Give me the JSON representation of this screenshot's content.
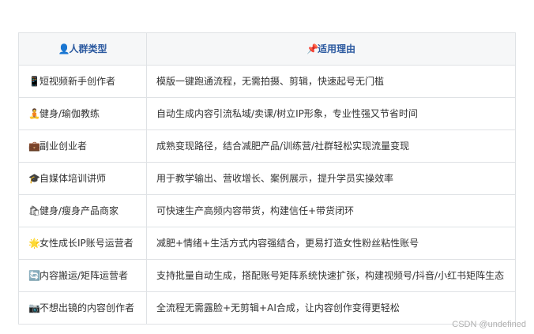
{
  "table": {
    "headers": [
      {
        "icon": "👤",
        "icon_name": "person-icon",
        "label": "人群类型"
      },
      {
        "icon": "📌",
        "icon_name": "pushpin-icon",
        "label": "适用理由"
      }
    ],
    "rows": [
      {
        "icon": "📱",
        "icon_name": "mobile-phone-icon",
        "type": "短视频新手创作者",
        "reason": "模版一键跑通流程，无需拍摄、剪辑，快速起号无门槛"
      },
      {
        "icon": "🧘",
        "icon_name": "yoga-icon",
        "type": "健身/瑜伽教练",
        "reason": "自动生成内容引流私域/卖课/树立IP形象，专业性强又节省时间"
      },
      {
        "icon": "💼",
        "icon_name": "briefcase-icon",
        "type": "副业创业者",
        "reason": "成熟变现路径，结合减肥产品/训练营/社群轻松实现流量变现"
      },
      {
        "icon": "🎓",
        "icon_name": "graduation-cap-icon",
        "type": "自媒体培训讲师",
        "reason": "用于教学输出、营收增长、案例展示，提升学员实操效率"
      },
      {
        "icon": "🛍",
        "icon_name": "shopping-bags-icon",
        "type": "健身/瘦身产品商家",
        "reason": "可快速生产高频内容带货，构建信任+带货闭环"
      },
      {
        "icon": "🌟",
        "icon_name": "glowing-star-icon",
        "type": "女性成长IP账号运营者",
        "reason": "减肥+情绪+生活方式内容强结合，更易打造女性粉丝粘性账号"
      },
      {
        "icon": "🔄",
        "icon_name": "repeat-arrows-icon",
        "type": "内容搬运/矩阵运营者",
        "reason": "支持批量自动生成，搭配账号矩阵系统快速扩张，构建视频号/抖音/小红书矩阵生态"
      },
      {
        "icon": "📷",
        "icon_name": "camera-icon",
        "type": "不想出镜的内容创作者",
        "reason": "全流程无需露脸+无剪辑+AI合成，让内容创作变得更轻松"
      }
    ]
  },
  "watermark": "CSDN @undefined",
  "colors": {
    "header_text": "#2c5aa0",
    "header_bg": "#f6f7f8",
    "border": "#dfe2e5",
    "body_text": "#333333"
  }
}
